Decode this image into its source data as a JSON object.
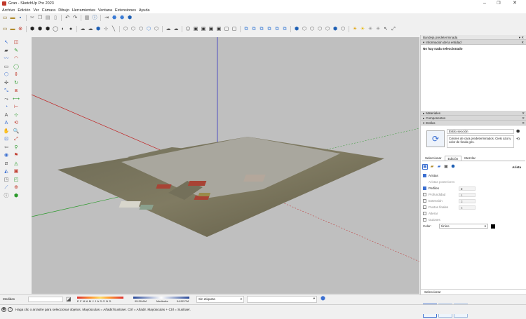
{
  "window": {
    "title": "Gran - SketchUp Pro 2023",
    "controls": [
      "–",
      "❐",
      "✕"
    ]
  },
  "menu": [
    "Archivo",
    "Edición",
    "Ver",
    "Cámara",
    "Dibujo",
    "Herramientas",
    "Ventana",
    "Extensiones",
    "Ayuda"
  ],
  "tray": {
    "title": "Bandeja predeterminada",
    "entity_info": {
      "header": "Información de la entidad",
      "status": "No hay nada seleccionado"
    },
    "sections": [
      {
        "label": "Materiales"
      },
      {
        "label": "Componentes"
      },
      {
        "label": "Estilos"
      }
    ],
    "styles": {
      "name": "Estilo sección",
      "description": "Colores de cara predeterminados. Cielo azul y color de fondo gris.",
      "tabs": [
        "Seleccionar",
        "Edición",
        "Mezclar"
      ],
      "active_category": "Arista",
      "edge_rows": [
        {
          "label": "Aristas",
          "checked": true
        },
        {
          "label": "Aristas posteriores",
          "checked": false
        },
        {
          "label": "Perfiles",
          "checked": true,
          "value": "2"
        },
        {
          "label": "Profundidad",
          "checked": false,
          "value": "4"
        },
        {
          "label": "Extensión",
          "checked": false,
          "value": "3"
        },
        {
          "label": "Puntos finales",
          "checked": false,
          "value": "6"
        },
        {
          "label": "Alterar",
          "checked": false
        },
        {
          "label": "Guiones",
          "checked": false
        }
      ],
      "color_label": "Color:",
      "color_value": "Único",
      "select_label": "Seleccionar",
      "model_dropdown": "Modelado fotográfico",
      "swatch_color": "#000000"
    }
  },
  "status": {
    "measure_label": "Medidas",
    "months": "E F M A M J J A S O N D",
    "time_start": "05:39 AM",
    "midday": "Mediodía",
    "time_end": "04:52 PM",
    "section_dropdown": "Sin etiqueta",
    "hint": "Haga clic o arrastre para seleccionar objetos. Mayúsculas = Añadir/Sustraer. Ctrl = Añadir. Mayúsculas + Ctrl = Sustraer."
  },
  "colors": {
    "sky": "#bfbfbf",
    "axis_red": "#c02020",
    "axis_green": "#2b9a2b",
    "axis_blue": "#2020c0"
  }
}
